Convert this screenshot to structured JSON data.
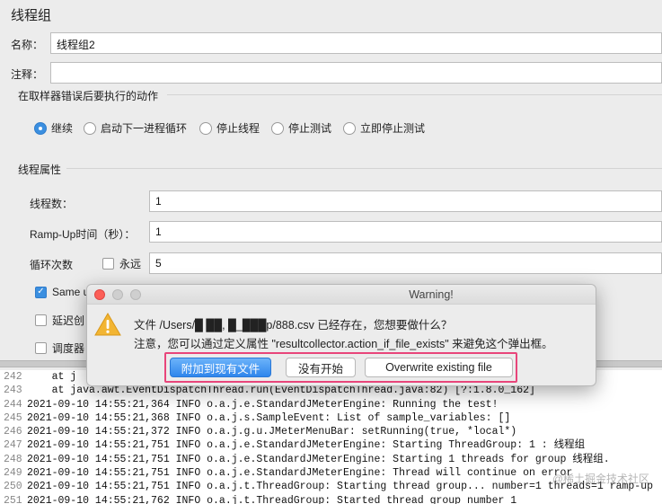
{
  "panel_title": "线程组",
  "name_label": "名称：",
  "name_value": "线程组2",
  "comment_label": "注释：",
  "comment_value": "",
  "error_section": {
    "title": "在取样器错误后要执行的动作",
    "options": [
      "继续",
      "启动下一进程循环",
      "停止线程",
      "停止测试",
      "立即停止测试"
    ],
    "selected": "继续"
  },
  "thread_props": {
    "title": "线程属性",
    "threads_label": "线程数：",
    "threads_value": "1",
    "rampup_label": "Ramp-Up时间（秒）：",
    "rampup_value": "1",
    "loop_label": "循环次数",
    "forever_label": "永远",
    "forever_checked": false,
    "loop_value": "5",
    "same_user_label": "Same u",
    "same_user_checked": true,
    "delay_label": "延迟创",
    "delay_checked": false,
    "scheduler_label": "调度器",
    "scheduler_checked": false
  },
  "dialog": {
    "title": "Warning!",
    "message1": "文件 /Users/█ ██, █_███p/888.csv 已经存在，您想要做什么？",
    "message2": "注意，您可以通过定义属性 \"resultcollector.action_if_file_exists\" 来避免这个弹出框。",
    "buttons": [
      "附加到现有文件",
      "没有开始",
      "Overwrite existing file"
    ],
    "icon": "warning-icon"
  },
  "log": {
    "lines": [
      {
        "num": "242",
        "text": "    at j"
      },
      {
        "num": "243",
        "text": "    at java.awt.EventDispatchThread.run(EventDispatchThread.java:82) [?:1.8.0_162]"
      },
      {
        "num": "244",
        "text": "2021-09-10 14:55:21,364 INFO o.a.j.e.StandardJMeterEngine: Running the test!"
      },
      {
        "num": "245",
        "text": "2021-09-10 14:55:21,368 INFO o.a.j.s.SampleEvent: List of sample_variables: []"
      },
      {
        "num": "246",
        "text": "2021-09-10 14:55:21,372 INFO o.a.j.g.u.JMeterMenuBar: setRunning(true, *local*)"
      },
      {
        "num": "247",
        "text": "2021-09-10 14:55:21,751 INFO o.a.j.e.StandardJMeterEngine: Starting ThreadGroup: 1 : 线程组"
      },
      {
        "num": "248",
        "text": "2021-09-10 14:55:21,751 INFO o.a.j.e.StandardJMeterEngine: Starting 1 threads for group 线程组."
      },
      {
        "num": "249",
        "text": "2021-09-10 14:55:21,751 INFO o.a.j.e.StandardJMeterEngine: Thread will continue on error"
      },
      {
        "num": "250",
        "text": "2021-09-10 14:55:21,751 INFO o.a.j.t.ThreadGroup: Starting thread group... number=1 threads=1 ramp-up"
      },
      {
        "num": "251",
        "text": "2021-09-10 14:55:21,762 INFO o.a.j.t.ThreadGroup: Started thread group number 1"
      }
    ]
  },
  "watermark": "@稀土掘金技术社区",
  "colors": {
    "accent": "#3b8fe0",
    "highlight": "#e8457a",
    "traffic_red": "#fc5f57",
    "traffic_gray": "#cfcfcf"
  }
}
